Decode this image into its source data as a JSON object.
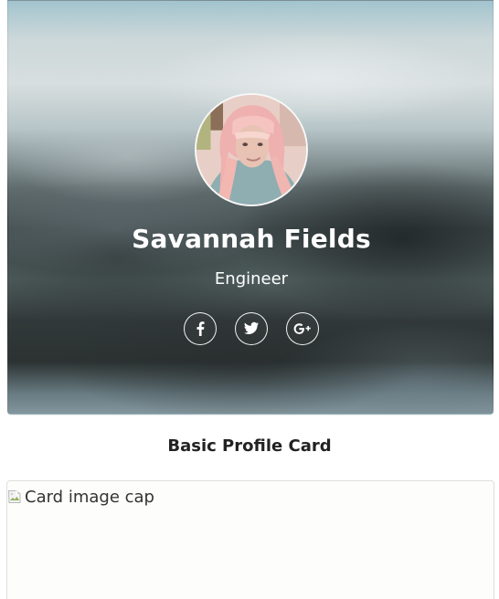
{
  "profile_card": {
    "name": "Savannah Fields",
    "role": "Engineer",
    "avatar_icon": "profile-photo",
    "social_links": [
      {
        "name": "facebook-icon",
        "icon": "f"
      },
      {
        "name": "twitter-icon",
        "icon": "twitter"
      },
      {
        "name": "google-plus-icon",
        "icon": "G+"
      }
    ]
  },
  "section": {
    "title": "Basic Profile Card"
  },
  "image_card": {
    "image_alt": "Card image cap",
    "broken_icon": "broken-image-icon"
  }
}
